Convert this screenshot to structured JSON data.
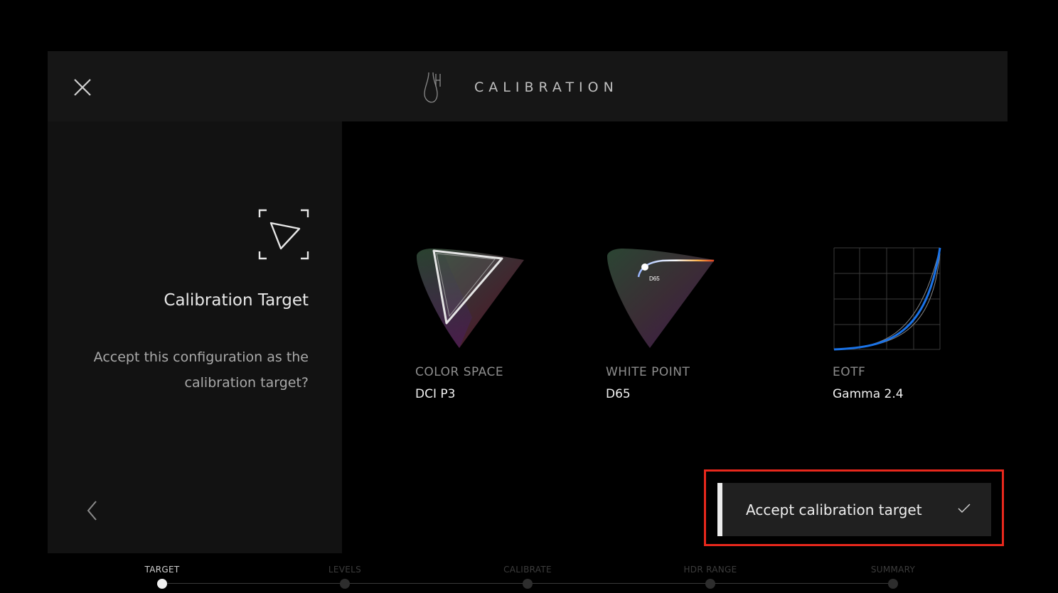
{
  "header": {
    "title": "CALIBRATION",
    "close_icon": "close-icon",
    "logo_icon": "logo-icon"
  },
  "panel": {
    "icon": "calibration-target-icon",
    "title": "Calibration Target",
    "description": "Accept this configuration as the calibration target?",
    "back_icon": "chevron-left-icon"
  },
  "cards": {
    "color_space": {
      "label": "COLOR SPACE",
      "value": "DCI P3",
      "icon": "gamut-triangle-icon"
    },
    "white_point": {
      "label": "WHITE POINT",
      "value": "D65",
      "diagram_label": "D65",
      "icon": "white-point-icon"
    },
    "eotf": {
      "label": "EOTF",
      "value": "Gamma 2.4",
      "icon": "gamma-curve-icon"
    }
  },
  "accept_button": {
    "label": "Accept calibration target",
    "icon": "checkmark-icon"
  },
  "steps": [
    {
      "label": "TARGET",
      "active": true
    },
    {
      "label": "LEVELS",
      "active": false
    },
    {
      "label": "CALIBRATE",
      "active": false
    },
    {
      "label": "HDR RANGE",
      "active": false
    },
    {
      "label": "SUMMARY",
      "active": false
    }
  ],
  "colors": {
    "highlight": "#e8281c",
    "curve": "#1a73e8",
    "background": "#000000",
    "panel": "#121212"
  }
}
